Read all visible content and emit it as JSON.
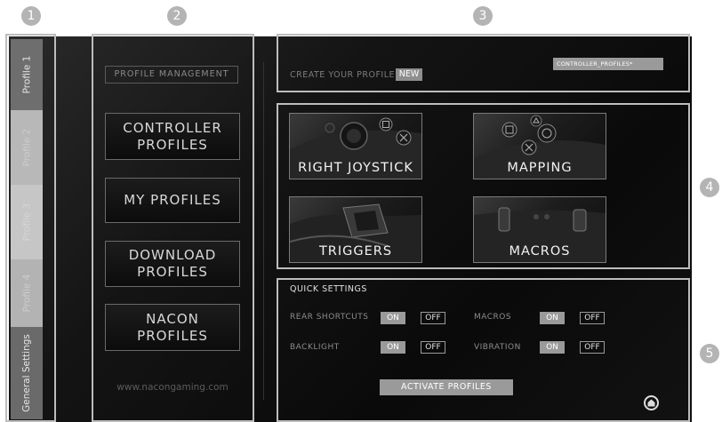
{
  "callouts": [
    "1",
    "2",
    "3",
    "4",
    "5"
  ],
  "tabs": {
    "profile1": "Profile 1",
    "profile2": "Profile 2",
    "profile3": "Profile 3",
    "profile4": "Profile 4",
    "general": "General Settings"
  },
  "profile_management": {
    "label": "PROFILE MANAGEMENT",
    "buttons": {
      "controller_profiles": "CONTROLLER\nPROFILES",
      "my_profiles": "MY PROFILES",
      "download_profiles": "DOWNLOAD\nPROFILES",
      "nacon_profiles": "NACON\nPROFILES"
    },
    "website": "www.nacongaming.com"
  },
  "create": {
    "title": "CREATE YOUR PROFILE",
    "badge": "NEW",
    "field_value": "CONTROLLER_PROFILES*"
  },
  "features": {
    "right_joystick": "RIGHT JOYSTICK",
    "mapping": "MAPPING",
    "triggers": "TRIGGERS",
    "macros": "MACROS"
  },
  "quick_settings": {
    "title": "QUICK SETTINGS",
    "rear_shortcuts": "REAR SHORTCUTS",
    "macros": "MACROS",
    "backlight": "BACKLIGHT",
    "vibration": "VIBRATION",
    "on": "ON",
    "off": "OFF",
    "activate": "ACTIVATE PROFILES"
  },
  "colors": {
    "panel": "#0f0f0f",
    "frame": "#bdbdbd",
    "accent": "#9a9a9a"
  }
}
